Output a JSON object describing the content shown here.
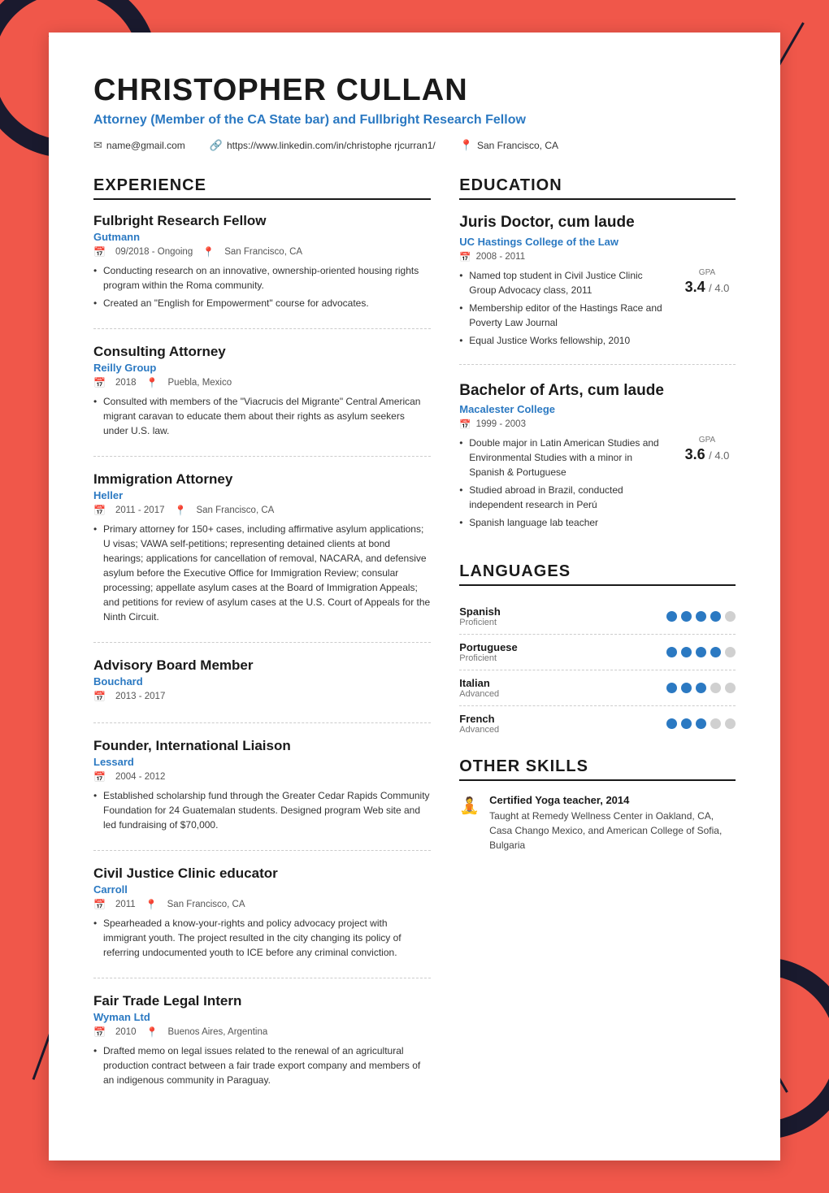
{
  "header": {
    "name": "CHRISTOPHER CULLAN",
    "title": "Attorney (Member of the CA State bar) and Fullbright Research Fellow",
    "email": "name@gmail.com",
    "linkedin": "https://www.linkedin.com/in/christophe rjcurran1/",
    "location": "San Francisco, CA"
  },
  "sections": {
    "experience_heading": "EXPERIENCE",
    "education_heading": "EDUCATION",
    "languages_heading": "LANGUAGES",
    "other_skills_heading": "OTHER SKILLS"
  },
  "experience": [
    {
      "title": "Fulbright Research Fellow",
      "company": "Gutmann",
      "date": "09/2018 - Ongoing",
      "location": "San Francisco, CA",
      "bullets": [
        "Conducting research on an innovative, ownership-oriented housing rights program within the Roma community.",
        "Created an \"English for Empowerment\" course for advocates."
      ]
    },
    {
      "title": "Consulting Attorney",
      "company": "Reilly Group",
      "date": "2018",
      "location": "Puebla, Mexico",
      "bullets": [
        "Consulted with members of the \"Viacrucis del Migrante\" Central American migrant caravan to educate them about their rights as asylum seekers under U.S. law."
      ]
    },
    {
      "title": "Immigration Attorney",
      "company": "Heller",
      "date": "2011 - 2017",
      "location": "San Francisco, CA",
      "bullets": [
        "Primary attorney for 150+ cases, including affirmative asylum applications; U visas; VAWA self-petitions; representing detained clients at bond hearings; applications for cancellation of removal, NACARA, and defensive asylum before the Executive Office for Immigration Review; consular processing; appellate asylum cases at the Board of Immigration Appeals; and petitions for review of asylum cases at the U.S. Court of Appeals for the Ninth Circuit."
      ]
    },
    {
      "title": "Advisory Board Member",
      "company": "Bouchard",
      "date": "2013 - 2017",
      "location": "",
      "bullets": []
    },
    {
      "title": "Founder, International Liaison",
      "company": "Lessard",
      "date": "2004 - 2012",
      "location": "",
      "bullets": [
        "Established scholarship fund through the Greater Cedar Rapids Community Foundation for 24 Guatemalan students. Designed program Web site and led fundraising of $70,000."
      ]
    },
    {
      "title": "Civil Justice Clinic educator",
      "company": "Carroll",
      "date": "2011",
      "location": "San Francisco, CA",
      "bullets": [
        "Spearheaded a know-your-rights and policy advocacy project with immigrant youth. The project resulted in the city changing its policy of referring undocumented youth to ICE before any criminal conviction."
      ]
    },
    {
      "title": "Fair Trade Legal Intern",
      "company": "Wyman Ltd",
      "date": "2010",
      "location": "Buenos Aires, Argentina",
      "bullets": [
        "Drafted memo on legal issues related to the renewal of an agricultural production contract between a fair trade export company and members of an indigenous community in Paraguay."
      ]
    }
  ],
  "education": [
    {
      "degree": "Juris Doctor, cum laude",
      "school": "UC Hastings College of the Law",
      "date": "2008 - 2011",
      "gpa": "3.4",
      "gpa_denom": "4.0",
      "bullets": [
        "Named top student in Civil Justice Clinic Group Advocacy class, 2011",
        "Membership editor of the Hastings Race and Poverty Law Journal",
        "Equal Justice Works fellowship, 2010"
      ]
    },
    {
      "degree": "Bachelor of Arts, cum laude",
      "school": "Macalester College",
      "date": "1999 - 2003",
      "gpa": "3.6",
      "gpa_denom": "4.0",
      "bullets": [
        "Double major in Latin American Studies and Environmental Studies with a minor in Spanish & Portuguese",
        "Studied abroad in Brazil, conducted independent research in Perú",
        "Spanish language lab teacher"
      ]
    }
  ],
  "languages": [
    {
      "name": "Spanish",
      "level": "Proficient",
      "filled": 4,
      "empty": 1
    },
    {
      "name": "Portuguese",
      "level": "Proficient",
      "filled": 4,
      "empty": 1
    },
    {
      "name": "Italian",
      "level": "Advanced",
      "filled": 3,
      "empty": 2
    },
    {
      "name": "French",
      "level": "Advanced",
      "filled": 3,
      "empty": 2
    }
  ],
  "other_skills": [
    {
      "icon": "🧘",
      "title": "Certified Yoga teacher, 2014",
      "description": "Taught at Remedy Wellness Center in Oakland, CA, Casa Chango Mexico, and American College of Sofia, Bulgaria"
    }
  ]
}
